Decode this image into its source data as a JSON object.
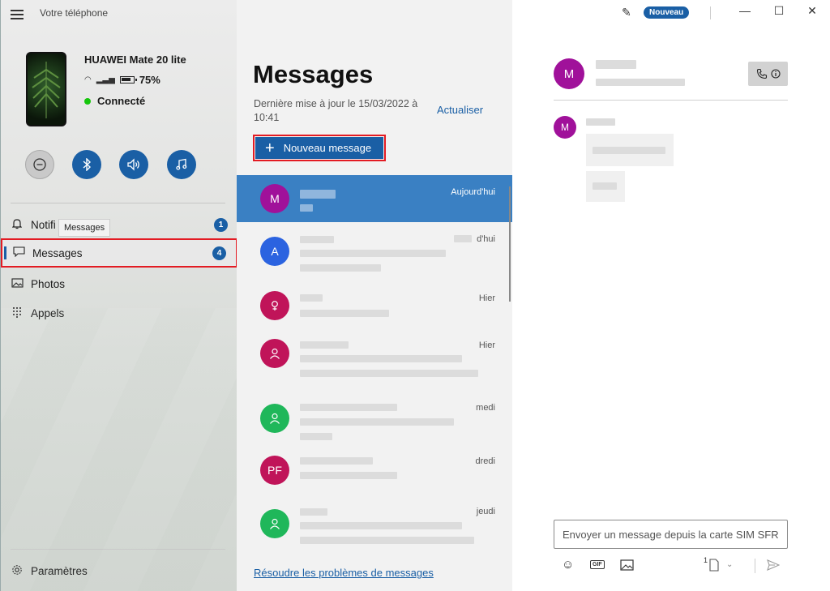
{
  "app": {
    "title": "Votre téléphone"
  },
  "device": {
    "name": "HUAWEI Mate 20 lite",
    "battery": "75%",
    "status": "Connecté"
  },
  "nav": {
    "notifications_label": "Notifi",
    "notifications_badge": "1",
    "tooltip": "Messages",
    "messages_label": "Messages",
    "messages_badge": "4",
    "photos_label": "Photos",
    "calls_label": "Appels",
    "settings_label": "Paramètres"
  },
  "messages": {
    "title": "Messages",
    "last_update": "Dernière mise à jour le 15/03/2022 à 10:41",
    "refresh": "Actualiser",
    "new_message": "Nouveau message",
    "troubleshoot": "Résoudre les problèmes de messages",
    "conversations": [
      {
        "initials": "M",
        "time": "Aujourd'hui",
        "color": "#a0119a"
      },
      {
        "initials": "A",
        "time": "d'hui",
        "color": "#2b63e0"
      },
      {
        "initials": "",
        "time": "Hier",
        "color": "#c01459"
      },
      {
        "initials": "",
        "time": "Hier",
        "color": "#c01459"
      },
      {
        "initials": "",
        "time": "medi",
        "color": "#1fb75a"
      },
      {
        "initials": "PF",
        "time": "dredi",
        "color": "#c01459"
      },
      {
        "initials": "",
        "time": "jeudi",
        "color": "#1fb75a"
      }
    ]
  },
  "titlebar": {
    "new_badge": "Nouveau"
  },
  "chat": {
    "avatar_initial": "M",
    "small_avatar_initial": "M",
    "compose_placeholder": "Envoyer un message depuis la carte SIM SFR",
    "sim_number": "1"
  },
  "colors": {
    "accent": "#1a5fa5",
    "highlight": "#e31b23",
    "active_row": "#3a80c3"
  }
}
